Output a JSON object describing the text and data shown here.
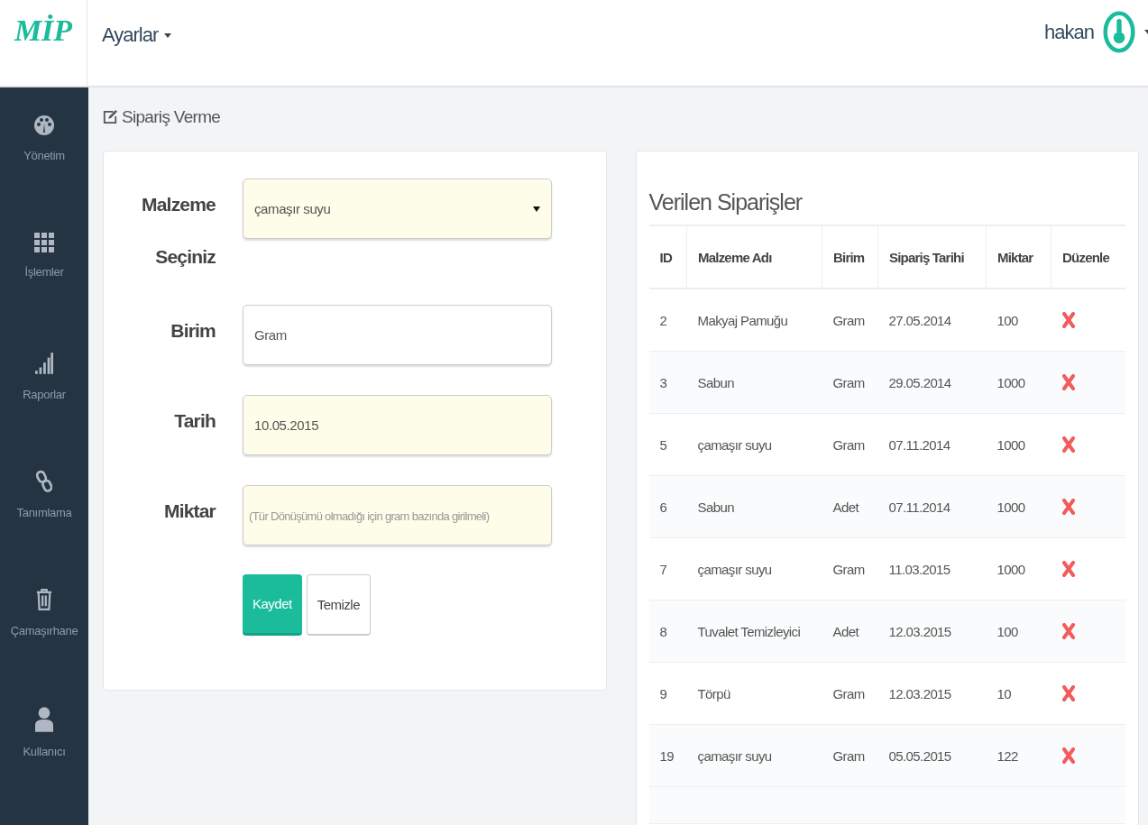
{
  "topbar": {
    "logo": "MİP",
    "menu": {
      "label": "Ayarlar"
    },
    "user": {
      "name": "hakan"
    }
  },
  "sidebar": {
    "items": [
      {
        "label": "Yönetim",
        "kind": "dashboard"
      },
      {
        "label": "İşlemler",
        "kind": "grid"
      },
      {
        "label": "Raporlar",
        "kind": "signal"
      },
      {
        "label": "Tanımlama",
        "kind": "link"
      },
      {
        "label": "Çamaşırhane",
        "kind": "trash"
      },
      {
        "label": "Kullanıcı",
        "kind": "user"
      }
    ]
  },
  "page_title": "Sipariş Verme",
  "form": {
    "fields": [
      {
        "label": "Malzeme Seçiniz",
        "kind": "select",
        "value": "çamaşır suyu"
      },
      {
        "label": "Birim",
        "kind": "text",
        "value": "Gram"
      },
      {
        "label": "Tarih",
        "kind": "date",
        "value": "10.05.2015"
      },
      {
        "label": "Miktar",
        "kind": "number",
        "placeholder": "(Tür Dönüşümü olmadığı için gram bazında girilmeli)"
      }
    ],
    "buttons": [
      {
        "label": "Kaydet",
        "kind": "primary"
      },
      {
        "label": "Temizle",
        "kind": "default"
      }
    ]
  },
  "orders": {
    "title": "Verilen Siparişler",
    "columns": [
      "ID",
      "Malzeme Adı",
      "Birim",
      "Sipariş Tarihi",
      "Miktar",
      "Düzenle"
    ],
    "rows": [
      [
        "2",
        "Makyaj Pamuğu",
        "Gram",
        "27.05.2014",
        "100"
      ],
      [
        "3",
        "Sabun",
        "Gram",
        "29.05.2014",
        "1000"
      ],
      [
        "5",
        "çamaşır suyu",
        "Gram",
        "07.11.2014",
        "1000"
      ],
      [
        "6",
        "Sabun",
        "Adet",
        "07.11.2014",
        "1000"
      ],
      [
        "7",
        "çamaşır suyu",
        "Gram",
        "11.03.2015",
        "1000"
      ],
      [
        "8",
        "Tuvalet Temizleyici",
        "Adet",
        "12.03.2015",
        "100"
      ],
      [
        "9",
        "Törpü",
        "Gram",
        "12.03.2015",
        "10"
      ],
      [
        "19",
        "çamaşır suyu",
        "Gram",
        "05.05.2015",
        "122"
      ]
    ]
  }
}
